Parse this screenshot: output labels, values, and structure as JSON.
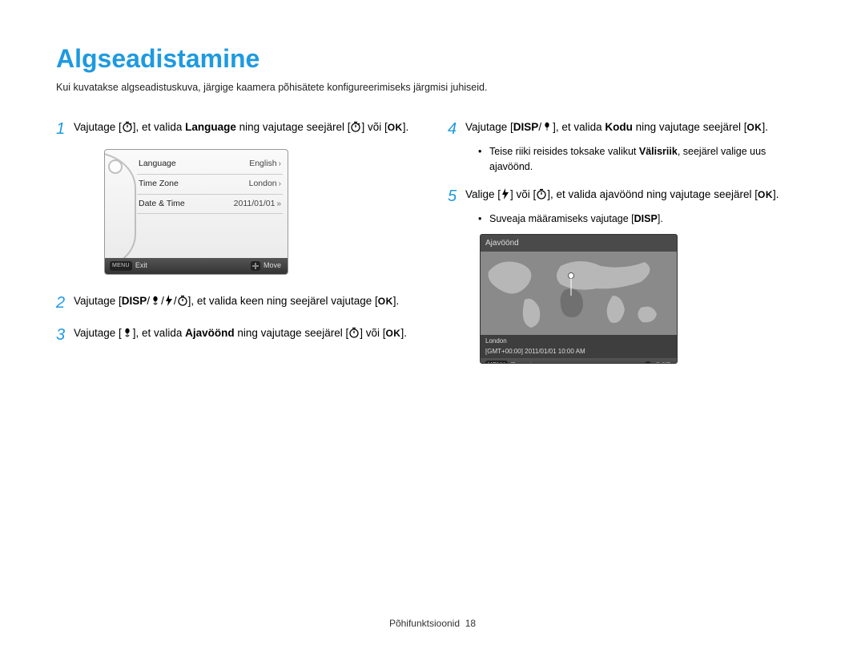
{
  "title": "Algseadistamine",
  "subtitle": "Kui kuvatakse algseadistuskuva, järgige kaamera põhisätete konfigureerimiseks järgmisi juhiseid.",
  "steps": {
    "s1a": "Vajutage [",
    "s1b": "], et valida ",
    "s1bold": "Language",
    "s1c": " ning vajutage seejärel [",
    "s1d": "] või [",
    "s1e": "].",
    "s2a": "Vajutage [",
    "s2b": "], et valida keen ning seejärel vajutage [",
    "s2c": "].",
    "s3a": "Vajutage [",
    "s3b": "], et valida ",
    "s3bold": "Ajavöönd",
    "s3c": " ning vajutage seejärel [",
    "s3d": "] või [",
    "s3e": "].",
    "s4a": "Vajutage [",
    "s4b": "], et valida ",
    "s4bold": "Kodu",
    "s4c": " ning vajutage seejärel [",
    "s4d": "].",
    "s4bullet_a": "Teise riiki reisides toksake valikut ",
    "s4bullet_bold": "Välisriik",
    "s4bullet_b": ", seejärel valige uus ajavöönd.",
    "s5a": "Valige [",
    "s5b": "] või [",
    "s5c": "], et valida ajavöönd ning vajutage seejärel [",
    "s5d": "].",
    "s5bullet": "Suveaja määramiseks vajutage [",
    "s5bullet_b": "]."
  },
  "nums": {
    "n1": "1",
    "n2": "2",
    "n3": "3",
    "n4": "4",
    "n5": "5"
  },
  "labels": {
    "disp": "DISP",
    "ok": "OK",
    "menu": "MENU"
  },
  "screen1": {
    "r1k": "Language",
    "r1v": "English",
    "r2k": "Time Zone",
    "r2v": "London",
    "r3k": "Date & Time",
    "r3v": "2011/01/01",
    "exit": "Exit",
    "move": "Move"
  },
  "screen2": {
    "head": "Ajavöönd",
    "city": "London",
    "time": "[GMT+00:00] 2011/01/01 10:00 AM",
    "back": "Tagasi",
    "dst": "DST"
  },
  "footer": {
    "label": "Põhifunktsioonid",
    "page": "18"
  }
}
